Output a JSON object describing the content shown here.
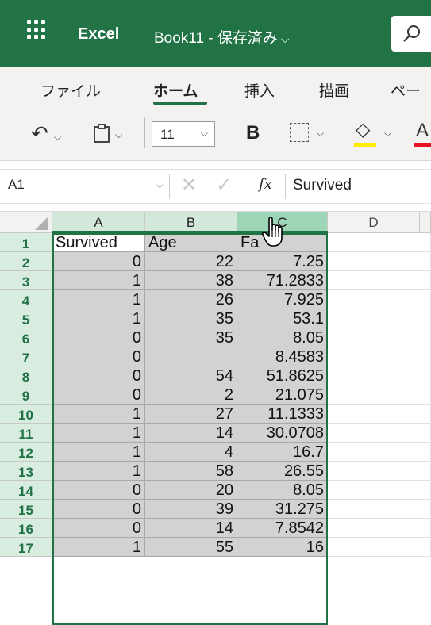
{
  "titlebar": {
    "app_name": "Excel",
    "doc_title": "Book11 - 保存済み",
    "title_chevron": "⌵",
    "search_icon": "search-icon",
    "accent": "#217346"
  },
  "tabs": {
    "items": [
      "ファイル",
      "ホーム",
      "挿入",
      "描画",
      "ペー"
    ],
    "active": "ホーム"
  },
  "toolbar": {
    "undo_icon": "↶",
    "chevron": "⌵",
    "clipboard_icon": "📋",
    "font_size": "11",
    "bold_label": "B",
    "fill_icon": "◇",
    "font_color_label": "A",
    "fill_color": "#ffeb00",
    "font_color": "#e81123"
  },
  "formula_bar": {
    "name_box": "A1",
    "cancel_icon": "✕",
    "enter_icon": "✓",
    "fx_label": "fx",
    "content": "Survived"
  },
  "grid": {
    "columns": [
      "A",
      "B",
      "C",
      "D"
    ],
    "rows": [
      {
        "n": "1",
        "a": "Survived",
        "b": "Age",
        "c": "Fa"
      },
      {
        "n": "2",
        "a": "0",
        "b": "22",
        "c": "7.25"
      },
      {
        "n": "3",
        "a": "1",
        "b": "38",
        "c": "71.2833"
      },
      {
        "n": "4",
        "a": "1",
        "b": "26",
        "c": "7.925"
      },
      {
        "n": "5",
        "a": "1",
        "b": "35",
        "c": "53.1"
      },
      {
        "n": "6",
        "a": "0",
        "b": "35",
        "c": "8.05"
      },
      {
        "n": "7",
        "a": "0",
        "b": "",
        "c": "8.4583"
      },
      {
        "n": "8",
        "a": "0",
        "b": "54",
        "c": "51.8625"
      },
      {
        "n": "9",
        "a": "0",
        "b": "2",
        "c": "21.075"
      },
      {
        "n": "10",
        "a": "1",
        "b": "27",
        "c": "11.1333"
      },
      {
        "n": "11",
        "a": "1",
        "b": "14",
        "c": "30.0708"
      },
      {
        "n": "12",
        "a": "1",
        "b": "4",
        "c": "16.7"
      },
      {
        "n": "13",
        "a": "1",
        "b": "58",
        "c": "26.55"
      },
      {
        "n": "14",
        "a": "0",
        "b": "20",
        "c": "8.05"
      },
      {
        "n": "15",
        "a": "0",
        "b": "39",
        "c": "31.275"
      },
      {
        "n": "16",
        "a": "0",
        "b": "14",
        "c": "7.8542"
      },
      {
        "n": "17",
        "a": "1",
        "b": "55",
        "c": "16"
      }
    ]
  }
}
